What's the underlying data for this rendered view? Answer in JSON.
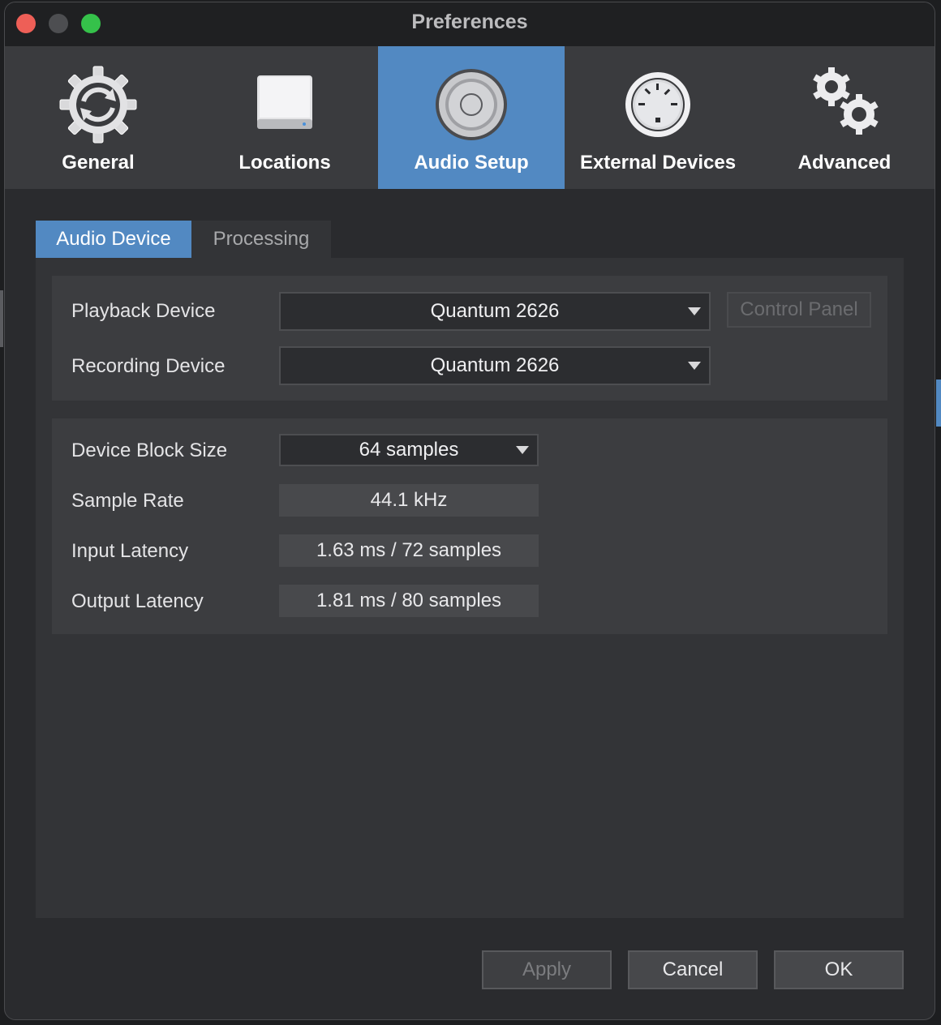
{
  "window": {
    "title": "Preferences"
  },
  "toolbar": {
    "items": [
      {
        "label": "General",
        "icon": "gear-cycle-icon",
        "active": false
      },
      {
        "label": "Locations",
        "icon": "drive-icon",
        "active": false
      },
      {
        "label": "Audio Setup",
        "icon": "speaker-icon",
        "active": true
      },
      {
        "label": "External Devices",
        "icon": "midi-connector-icon",
        "active": false
      },
      {
        "label": "Advanced",
        "icon": "gears-icon",
        "active": false
      }
    ]
  },
  "subtabs": [
    {
      "label": "Audio Device",
      "active": true
    },
    {
      "label": "Processing",
      "active": false
    }
  ],
  "device_group": {
    "playback_label": "Playback Device",
    "playback_value": "Quantum 2626",
    "recording_label": "Recording Device",
    "recording_value": "Quantum 2626",
    "control_panel_label": "Control Panel"
  },
  "settings_group": {
    "block_size_label": "Device Block Size",
    "block_size_value": "64 samples",
    "sample_rate_label": "Sample Rate",
    "sample_rate_value": "44.1 kHz",
    "input_latency_label": "Input Latency",
    "input_latency_value": "1.63 ms / 72 samples",
    "output_latency_label": "Output Latency",
    "output_latency_value": "1.81 ms / 80 samples"
  },
  "footer": {
    "apply_label": "Apply",
    "cancel_label": "Cancel",
    "ok_label": "OK"
  },
  "colors": {
    "accent": "#5289c2",
    "window_bg": "#2a2b2e",
    "titlebar_bg": "#1f2022",
    "toolbar_bg": "#3a3b3e"
  }
}
